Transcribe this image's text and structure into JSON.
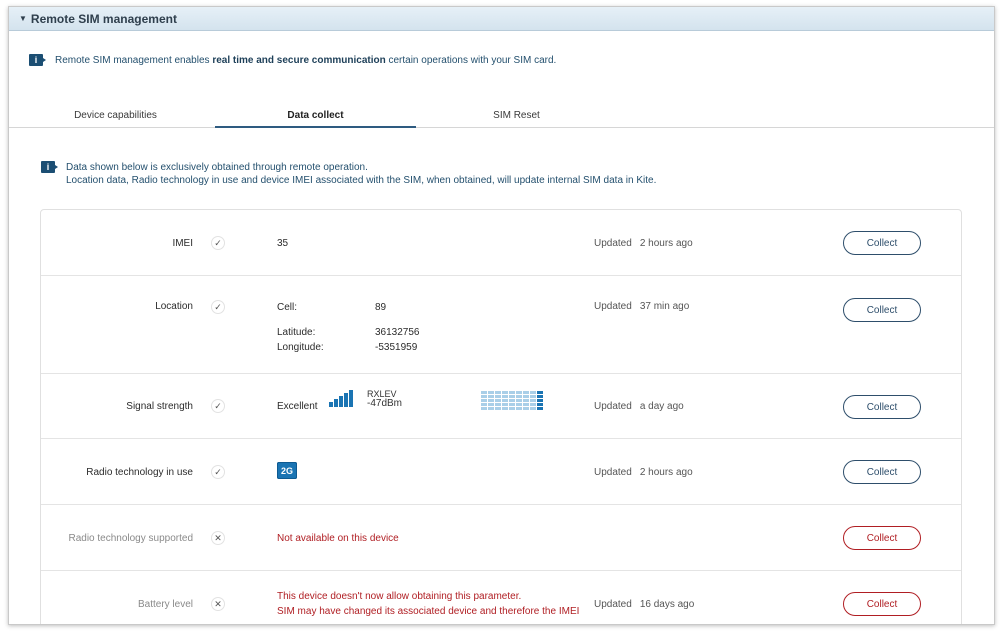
{
  "panel": {
    "title": "Remote SIM management"
  },
  "intro": {
    "text_before": "Remote SIM management enables ",
    "text_bold": "real time and secure communication",
    "text_after": " certain operations with your SIM card."
  },
  "tabs": [
    {
      "label": "Device capabilities",
      "active": false
    },
    {
      "label": "Data collect",
      "active": true
    },
    {
      "label": "SIM Reset",
      "active": false
    }
  ],
  "notice": {
    "line1": "Data shown below is exclusively obtained through remote operation.",
    "line2": "Location data, Radio technology in use and device IMEI associated with the SIM, when obtained, will update internal SIM data in Kite."
  },
  "rows": {
    "imei": {
      "label": "IMEI",
      "status": "✓",
      "value": "35",
      "updated": "Updated",
      "ago": "2 hours ago",
      "button": "Collect"
    },
    "location": {
      "label": "Location",
      "status": "✓",
      "cell_label": "Cell:",
      "cell_value": "89",
      "lat_label": "Latitude:",
      "lat_value": "36132756",
      "lon_label": "Longitude:",
      "lon_value": "-5351959",
      "updated": "Updated",
      "ago": "37 min ago",
      "button": "Collect"
    },
    "signal": {
      "label": "Signal strength",
      "status": "✓",
      "quality": "Excellent",
      "rxlev_label": "RXLEV",
      "rxlev_value": "-47dBm",
      "updated": "Updated",
      "ago": "a day ago",
      "button": "Collect"
    },
    "radio_use": {
      "label": "Radio technology in use",
      "status": "✓",
      "tech": "2G",
      "updated": "Updated",
      "ago": "2 hours ago",
      "button": "Collect"
    },
    "radio_supported": {
      "label": "Radio technology supported",
      "status": "✕",
      "error": "Not available on this device",
      "button": "Collect"
    },
    "battery": {
      "label": "Battery level",
      "status": "✕",
      "error1": "This device doesn't now allow obtaining this parameter.",
      "error2": "SIM may have changed its associated device and therefore the IMEI",
      "updated": "Updated",
      "ago": "16 days ago",
      "button": "Collect"
    }
  },
  "colors": {
    "accent": "#1a74b3",
    "navy": "#2e4e6b",
    "error": "#b01e23"
  }
}
